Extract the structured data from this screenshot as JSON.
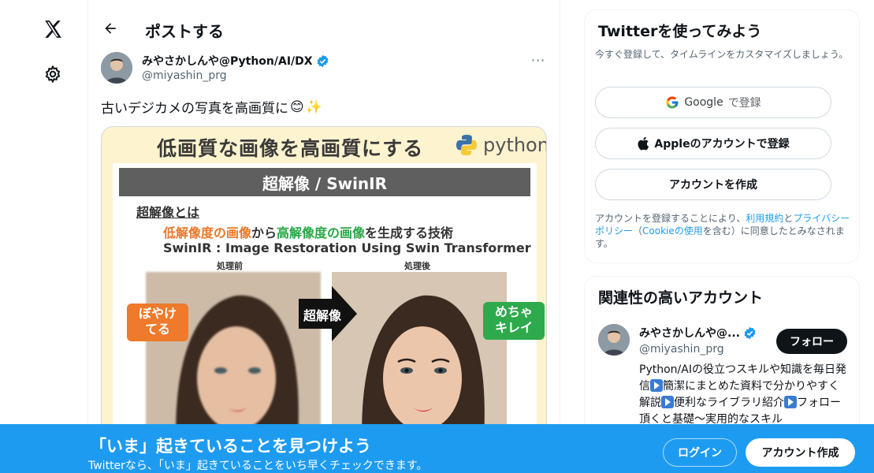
{
  "nav": {
    "logo_icon": "x-logo-icon",
    "settings_icon": "gear-icon"
  },
  "header": {
    "title": "ポストする"
  },
  "tweet": {
    "author_name": "みやさかしんや@Python/AI/DX",
    "author_handle": "@miyashin_prg",
    "text": "古いデジカメの写真を高画質に",
    "emoji_smile": "😊",
    "emoji_sparkles": "✨",
    "more_label": "···"
  },
  "media": {
    "title": "低画質な画像を高画質にする",
    "logo_text": "python",
    "band": "超解像 / SwinIR",
    "label": "超解像とは",
    "line_part1": "低解像度の画像",
    "line_part2": "から",
    "line_part3": "高解像度の画像",
    "line_part4": "を生成する技術",
    "subline": "SwinIR : Image Restoration Using Swin Transformer",
    "caption_before": "処理前",
    "caption_after": "処理後",
    "arrow_label": "超解像",
    "bubble_before_l1": "ぼやけ",
    "bubble_before_l2": "てる",
    "bubble_after_l1": "めちゃ",
    "bubble_after_l2": "キレイ"
  },
  "signup": {
    "title": "Twitterを使ってみよう",
    "subtitle": "今すぐ登録して、タイムラインをカスタマイズしましょう。",
    "google_label": "Google",
    "google_suffix": "で登録",
    "apple_label": "Appleのアカウントで登録",
    "create_label": "アカウントを作成",
    "terms_prefix": "アカウントを登録することにより、",
    "terms_link": "利用規約",
    "terms_and": "と",
    "privacy_link": "プライバシーポリシー",
    "terms_paren_open": "（",
    "cookie_link": "Cookieの使用",
    "terms_suffix": "を含む）に同意したとみなされます。"
  },
  "related": {
    "title": "関連性の高いアカウント",
    "name": "みやさかしんや@...",
    "handle": "@miyashin_prg",
    "follow_label": "フォロー",
    "bio_1": "Python/AIの役立つスキルや知識を毎日発信",
    "bio_2": "簡潔にまとめた資料で分かりやすく解説",
    "bio_3": "便利なライブラリ紹介",
    "bio_4": "フォロー頂くと基礎〜実用的なスキル"
  },
  "banner": {
    "title": "「いま」起きていることを見つけよう",
    "subtitle": "Twitterなら、「いま」起きていることをいち早くチェックできます。",
    "login_label": "ログイン",
    "signup_label": "アカウント作成"
  },
  "colors": {
    "accent": "#1d9bf0",
    "verified": "#1d9bf0"
  }
}
